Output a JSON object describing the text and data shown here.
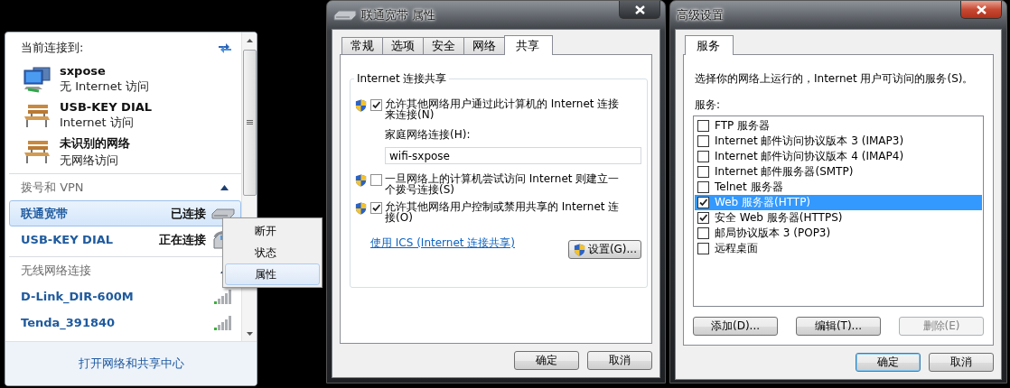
{
  "network_flyout": {
    "header": "当前连接到:",
    "connections": [
      {
        "name": "sxpose",
        "status": "无 Internet 访问",
        "kind": "computer"
      },
      {
        "name": "USB-KEY DIAL",
        "status": "Internet 访问",
        "kind": "bench"
      },
      {
        "name": "未识别的网络",
        "status": "无网络访问",
        "kind": "bench"
      }
    ],
    "sections": [
      {
        "title": "拨号和 VPN",
        "expanded": true,
        "items": [
          {
            "name": "联通宽带",
            "status": "已连接",
            "selected": true,
            "kind": "modem"
          },
          {
            "name": "USB-KEY DIAL",
            "status": "正在连接",
            "selected": false,
            "kind": "phone"
          }
        ]
      },
      {
        "title": "无线网络连接",
        "expanded": true,
        "items": [
          {
            "name": "D-Link_DIR-600M",
            "selected": false,
            "kind": "wifi"
          },
          {
            "name": "Tenda_391840",
            "selected": false,
            "kind": "wifi"
          }
        ]
      }
    ],
    "footer_link": "打开网络和共享中心"
  },
  "context_menu": [
    {
      "label": "断开",
      "selected": false
    },
    {
      "label": "状态",
      "selected": false
    },
    {
      "label": "属性",
      "selected": true
    }
  ],
  "properties_dialog": {
    "title": "联通宽带 属性",
    "tabs": [
      {
        "label": "常规",
        "selected": false
      },
      {
        "label": "选项",
        "selected": false
      },
      {
        "label": "安全",
        "selected": false
      },
      {
        "label": "网络",
        "selected": false
      },
      {
        "label": "共享",
        "selected": true
      }
    ],
    "group_title": "Internet 连接共享",
    "options": [
      {
        "kind": "checkbox",
        "label": "允许其他网络用户通过此计算机的 Internet 连接来连接(N)",
        "checked": true
      },
      {
        "kind": "field",
        "label": "家庭网络连接(H):",
        "value": "wifi-sxpose"
      },
      {
        "kind": "checkbox",
        "label": "一旦网络上的计算机尝试访问 Internet 则建立一个拨号连接(S)",
        "checked": false
      },
      {
        "kind": "checkbox",
        "label": "允许其他网络用户控制或禁用共享的 Internet 连接(O)",
        "checked": true
      }
    ],
    "link": "使用 ICS (Internet 连接共享)",
    "settings_button": "设置(G)...",
    "buttons": [
      {
        "label": "确定",
        "default": false
      },
      {
        "label": "取消",
        "default": false
      }
    ]
  },
  "advanced_dialog": {
    "title": "高级设置",
    "tabs": [
      {
        "label": "服务",
        "selected": true
      }
    ],
    "description": "选择你的网络上运行的，Internet 用户可访问的服务(S)。",
    "list_label": "服务:",
    "services": [
      {
        "label": "FTP 服务器",
        "checked": false,
        "selected": false
      },
      {
        "label": "Internet 邮件访问协议版本 3 (IMAP3)",
        "checked": false,
        "selected": false
      },
      {
        "label": "Internet 邮件访问协议版本 4 (IMAP4)",
        "checked": false,
        "selected": false
      },
      {
        "label": "Internet 邮件服务器(SMTP)",
        "checked": false,
        "selected": false
      },
      {
        "label": "Telnet 服务器",
        "checked": false,
        "selected": false
      },
      {
        "label": "Web 服务器(HTTP)",
        "checked": true,
        "selected": true
      },
      {
        "label": "安全 Web 服务器(HTTPS)",
        "checked": true,
        "selected": false
      },
      {
        "label": "邮局协议版本 3 (POP3)",
        "checked": false,
        "selected": false
      },
      {
        "label": "远程桌面",
        "checked": false,
        "selected": false
      }
    ],
    "actions": [
      {
        "label": "添加(D)...",
        "disabled": false
      },
      {
        "label": "编辑(T)...",
        "disabled": false
      },
      {
        "label": "删除(E)",
        "disabled": true
      }
    ],
    "buttons": [
      {
        "label": "确定",
        "default": true
      },
      {
        "label": "取消",
        "default": false
      }
    ]
  }
}
